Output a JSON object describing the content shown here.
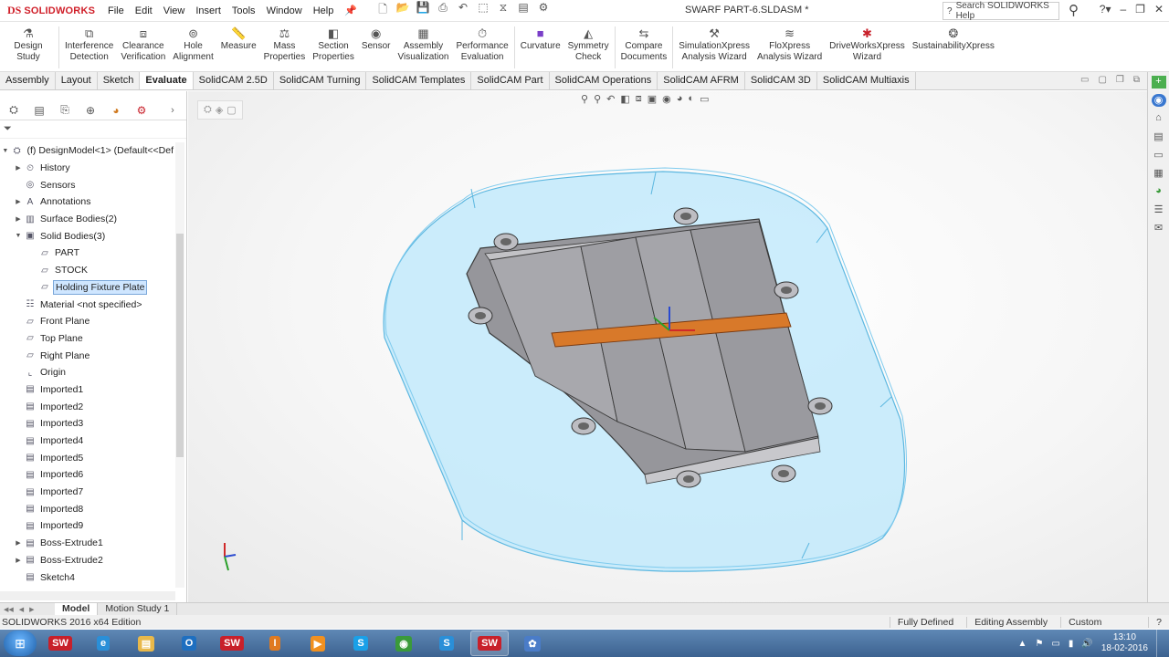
{
  "app": {
    "logo_mark": "DS",
    "logo_text": "SOLIDWORKS",
    "document_title": "SWARF PART-6.SLDASM *",
    "menus": [
      "File",
      "Edit",
      "View",
      "Insert",
      "Tools",
      "Window",
      "Help"
    ],
    "help_search_placeholder": "Search SOLIDWORKS Help"
  },
  "command_manager": {
    "items": [
      {
        "label": "Design Study",
        "icon": "design-study-icon"
      },
      {
        "label": "Interference\nDetection",
        "icon": "interference-icon"
      },
      {
        "label": "Clearance\nVerification",
        "icon": "clearance-icon"
      },
      {
        "label": "Hole\nAlignment",
        "icon": "hole-icon"
      },
      {
        "label": "Measure",
        "icon": "measure-icon"
      },
      {
        "label": "Mass\nProperties",
        "icon": "mass-icon"
      },
      {
        "label": "Section\nProperties",
        "icon": "section-icon"
      },
      {
        "label": "Sensor",
        "icon": "sensor-icon"
      },
      {
        "label": "Assembly\nVisualization",
        "icon": "assembly-vis-icon"
      },
      {
        "label": "Performance\nEvaluation",
        "icon": "performance-icon"
      },
      {
        "label": "Curvature",
        "icon": "curvature-icon"
      },
      {
        "label": "Symmetry\nCheck",
        "icon": "symmetry-icon"
      },
      {
        "label": "Compare\nDocuments",
        "icon": "compare-icon"
      },
      {
        "label": "SimulationXpress\nAnalysis Wizard",
        "icon": "simxpress-icon"
      },
      {
        "label": "FloXpress\nAnalysis Wizard",
        "icon": "floxpress-icon"
      },
      {
        "label": "DriveWorksXpress\nWizard",
        "icon": "driveworks-icon"
      },
      {
        "label": "SustainabilityXpress",
        "icon": "sustainability-icon"
      }
    ]
  },
  "tabs": [
    "Assembly",
    "Layout",
    "Sketch",
    "Evaluate",
    "SolidCAM 2.5D",
    "SolidCAM Turning",
    "SolidCAM Templates",
    "SolidCAM Part",
    "SolidCAM Operations",
    "SolidCAM AFRM",
    "SolidCAM 3D",
    "SolidCAM Multiaxis"
  ],
  "active_tab": "Evaluate",
  "feature_tree": {
    "root": "(f) DesignModel<1> (Default<<Def",
    "nodes": [
      {
        "label": "History",
        "indent": 1,
        "arrow": "▶"
      },
      {
        "label": "Sensors",
        "indent": 1,
        "arrow": ""
      },
      {
        "label": "Annotations",
        "indent": 1,
        "arrow": "▶"
      },
      {
        "label": "Surface Bodies(2)",
        "indent": 1,
        "arrow": "▶"
      },
      {
        "label": "Solid Bodies(3)",
        "indent": 1,
        "arrow": "▼"
      },
      {
        "label": "PART",
        "indent": 2,
        "arrow": ""
      },
      {
        "label": "STOCK",
        "indent": 2,
        "arrow": ""
      },
      {
        "label": "Holding Fixture Plate",
        "indent": 2,
        "arrow": "",
        "selected": true
      },
      {
        "label": "Material <not specified>",
        "indent": 1,
        "arrow": ""
      },
      {
        "label": "Front Plane",
        "indent": 1,
        "arrow": ""
      },
      {
        "label": "Top Plane",
        "indent": 1,
        "arrow": ""
      },
      {
        "label": "Right Plane",
        "indent": 1,
        "arrow": ""
      },
      {
        "label": "Origin",
        "indent": 1,
        "arrow": ""
      },
      {
        "label": "Imported1",
        "indent": 1,
        "arrow": ""
      },
      {
        "label": "Imported2",
        "indent": 1,
        "arrow": ""
      },
      {
        "label": "Imported3",
        "indent": 1,
        "arrow": ""
      },
      {
        "label": "Imported4",
        "indent": 1,
        "arrow": ""
      },
      {
        "label": "Imported5",
        "indent": 1,
        "arrow": ""
      },
      {
        "label": "Imported6",
        "indent": 1,
        "arrow": ""
      },
      {
        "label": "Imported7",
        "indent": 1,
        "arrow": ""
      },
      {
        "label": "Imported8",
        "indent": 1,
        "arrow": ""
      },
      {
        "label": "Imported9",
        "indent": 1,
        "arrow": ""
      },
      {
        "label": "Boss-Extrude1",
        "indent": 1,
        "arrow": "▶"
      },
      {
        "label": "Boss-Extrude2",
        "indent": 1,
        "arrow": "▶"
      },
      {
        "label": "Sketch4",
        "indent": 1,
        "arrow": ""
      }
    ]
  },
  "bottom_tabs": [
    "Model",
    "Motion Study 1"
  ],
  "status": {
    "edition": "SOLIDWORKS 2016 x64 Edition",
    "fully_defined": "Fully Defined",
    "editing": "Editing Assembly",
    "units": "Custom"
  },
  "taskbar": {
    "time": "13:10",
    "date": "18-02-2016",
    "apps": [
      {
        "label": "SW",
        "icon": "solidworks-2015-icon",
        "color": "#c8202a"
      },
      {
        "label": "e",
        "icon": "internet-explorer-icon",
        "color": "#2a8fd8"
      },
      {
        "label": "▤",
        "icon": "file-explorer-icon",
        "color": "#e8b84a"
      },
      {
        "label": "O",
        "icon": "outlook-icon",
        "color": "#1e6fc0"
      },
      {
        "label": "SW",
        "icon": "solidworks-2016-icon",
        "color": "#c8202a"
      },
      {
        "label": "I",
        "icon": "ipro-icon",
        "color": "#e07a20"
      },
      {
        "label": "▶",
        "icon": "media-player-icon",
        "color": "#f09020"
      },
      {
        "label": "S",
        "icon": "skype-icon",
        "color": "#1aa0e8"
      },
      {
        "label": "◉",
        "icon": "chrome-icon",
        "color": "#3a9a3a"
      },
      {
        "label": "S",
        "icon": "skype-business-icon",
        "color": "#2a8fd8"
      },
      {
        "label": "SW",
        "icon": "solidworks-active-icon",
        "color": "#c8202a",
        "active": true
      },
      {
        "label": "✿",
        "icon": "flower-app-icon",
        "color": "#4a7cc8"
      }
    ]
  },
  "colors": {
    "brand_red": "#d0202a",
    "fixture_blue": "#a8e4f8",
    "part_gray": "#8d8d92",
    "highlight_orange": "#e07820"
  }
}
